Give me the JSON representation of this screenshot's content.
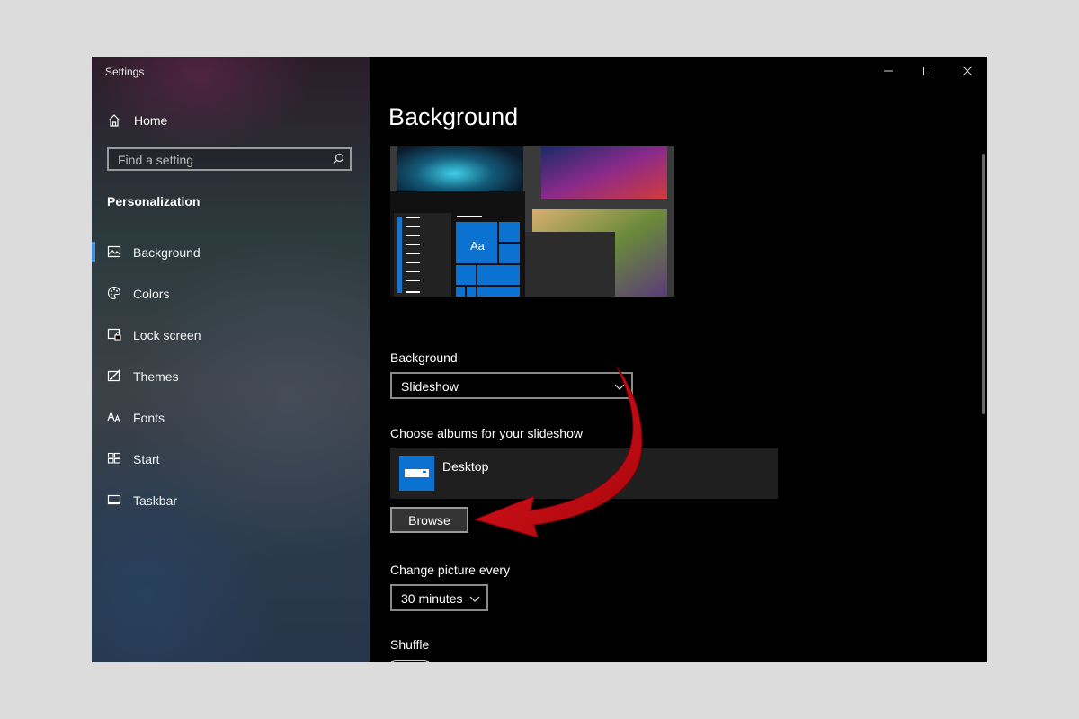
{
  "window": {
    "title": "Settings"
  },
  "sidebar": {
    "home_label": "Home",
    "search_placeholder": "Find a setting",
    "section_title": "Personalization",
    "items": [
      {
        "label": "Background",
        "icon": "image-icon",
        "active": true
      },
      {
        "label": "Colors",
        "icon": "palette-icon"
      },
      {
        "label": "Lock screen",
        "icon": "lock-screen-icon"
      },
      {
        "label": "Themes",
        "icon": "themes-icon"
      },
      {
        "label": "Fonts",
        "icon": "fonts-icon"
      },
      {
        "label": "Start",
        "icon": "start-icon"
      },
      {
        "label": "Taskbar",
        "icon": "taskbar-icon"
      }
    ]
  },
  "main": {
    "title": "Background",
    "preview_tile_text": "Aa",
    "background_label": "Background",
    "background_value": "Slideshow",
    "albums_label": "Choose albums for your slideshow",
    "album_name": "Desktop",
    "browse_label": "Browse",
    "change_label": "Change picture every",
    "change_value": "30 minutes",
    "shuffle_label": "Shuffle"
  },
  "colors": {
    "accent": "#0c72d1",
    "arrow": "#d0101a"
  }
}
